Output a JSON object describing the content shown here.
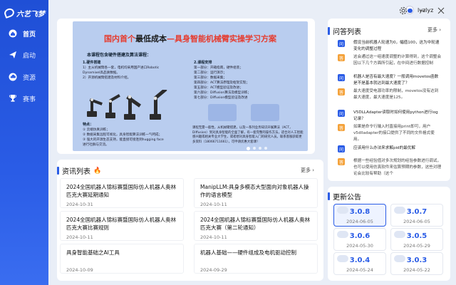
{
  "app": {
    "logo_text": "六艺飞梦"
  },
  "sidebar": {
    "items": [
      {
        "label": "首页",
        "icon": "home-icon",
        "active": true
      },
      {
        "label": "启动",
        "icon": "paper-plane-icon",
        "active": false
      },
      {
        "label": "资源",
        "icon": "cloud-icon",
        "active": false
      },
      {
        "label": "赛事",
        "icon": "trophy-icon",
        "active": false
      }
    ]
  },
  "topbar": {
    "username": "lyzlyz"
  },
  "banner": {
    "title_prefix": "国内首个",
    "title_emph": "最低成本",
    "title_suffix": "—具身智能机械臂实操学习方案",
    "subtitle": "本课程包含硬件搭建及算法课程：",
    "left_text": [
      "1.硬件搭建",
      "1）主从机械臂各一套，电机均采用国产进口Robotic",
      "Dynamixel高品质数据。",
      "2）开源机械臂搭建及材料介绍。"
    ],
    "features_title": "特点：",
    "features": [
      "① 云端仿真训练；",
      "② 数据采集远程可视化，具身智能算法训练一气呵成；",
      "③ 强大的开源生态支持，能直接可接连到hugging face",
      "进行社群与交流。"
    ],
    "right_title": "2.课程安排",
    "right_text": [
      "第一部分：开箱指南，硬件组装；",
      "第二部分：运行演示；",
      "第三部分：数据采集；",
      "第四部分：ACT算法原理及框架实现；",
      "第五部分：ACT模型验证及改进；",
      "第六部分：Diffusion算法及模型训练；",
      "第七部分：Diffusion模型验证及改进"
    ],
    "footer_text": "课程无需一般性，从机械臂搭建，以及一系列业务知识开展算法（ACT，Diffusion）到对具身智能的全面了解，有一套完整的操作方法，适合对人工智能感兴趣或相关专业大学生，或者想对具身智能入门的研究人员。联系客服获取更多资料（18066711661），可申请优惠大套课！"
  },
  "news": {
    "title": "资讯列表",
    "more": "更多",
    "items": [
      {
        "title": "2024全国机器人锦标赛暨国际仿人机器人奥林匹克大赛延期通知",
        "date": "2024-10-31"
      },
      {
        "title": "ManipLLM:具身多模态大型面向对象机器人操作的语言模型",
        "date": "2024-10-11"
      },
      {
        "title": "2024全国机器人锦标赛暨国际仿人机器人奥林匹克大赛比赛规则",
        "date": "2024-10-11"
      },
      {
        "title": "2024全国机器人锦标赛暨国际仿人机器人奥林匹克大赛（第二轮通知）",
        "date": "2024-10-11"
      },
      {
        "title": "具身智能基础之AI工具",
        "date": "2024-10-09"
      },
      {
        "title": "机器人基础——硬件组成及电机驱动控制",
        "date": "2024-09-29"
      }
    ]
  },
  "qa": {
    "title": "问答列表",
    "more": "更多",
    "items": [
      {
        "q": "假设当前机器人轮速为0，幅值100，这为中轮速变化的调整过程",
        "a": "这会通过这一组速度调整的计算得到，这个调整会因以下几个方面所引起，在中间进行数据控制"
      },
      {
        "q": "机器人是否有最大速度？一般调用movetos函数是不是基本就达到最大速度了？",
        "a": "最大速度受电源功率的限制，movetos没有达到最大速度，最大速度是125。"
      },
      {
        "q": "V5DLLAdapter读取时如何使用python进行log记录？",
        "a": "如果是命令行输入时直接用print即可，用户v5dlladapter的接口提供了不同的文件格式使用。"
      },
      {
        "q": "应该用什么办法来求解pid的最优解",
        "a": "根据一些经验值对多次规划的经验参数进行调试，也可以使用仿真软件来估算预期的参数，这些对理论会比较有帮助（这个"
      }
    ]
  },
  "updates": {
    "title": "更新公告",
    "items": [
      {
        "version": "3.0.8",
        "date": "2024-06-05"
      },
      {
        "version": "3.0.7",
        "date": "2024-06-05"
      },
      {
        "version": "3.0.6",
        "date": "2024-05-30"
      },
      {
        "version": "3.0.5",
        "date": "2024-05-29"
      },
      {
        "version": "3.0.4",
        "date": "2024-05-24"
      },
      {
        "version": "3.0.3",
        "date": "2024-05-22"
      }
    ]
  }
}
